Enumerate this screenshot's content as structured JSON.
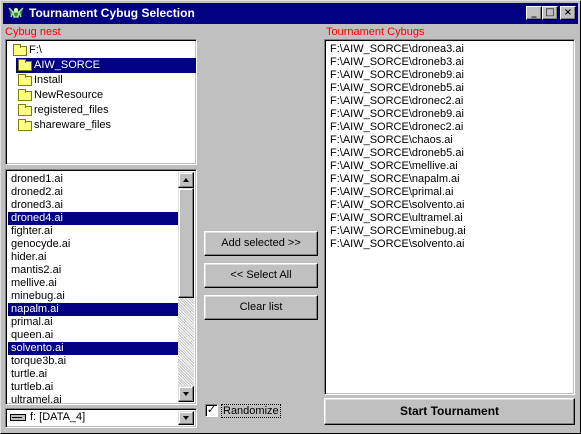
{
  "window": {
    "title": "Tournament Cybug Selection",
    "controls": {
      "minimize": "_",
      "maximize": "□",
      "close": "×"
    }
  },
  "left": {
    "nest_label": "Cybug nest",
    "directories": [
      {
        "label": "F:\\",
        "selected": false
      },
      {
        "label": "AIW_SORCE",
        "selected": true
      },
      {
        "label": "Install",
        "selected": false
      },
      {
        "label": "NewResource",
        "selected": false
      },
      {
        "label": "registered_files",
        "selected": false
      },
      {
        "label": "shareware_files",
        "selected": false
      }
    ],
    "files": [
      {
        "label": "droned1.ai",
        "selected": false
      },
      {
        "label": "droned2.ai",
        "selected": false
      },
      {
        "label": "droned3.ai",
        "selected": false
      },
      {
        "label": "droned4.ai",
        "selected": true
      },
      {
        "label": "fighter.ai",
        "selected": false
      },
      {
        "label": "genocyde.ai",
        "selected": false
      },
      {
        "label": "hider.ai",
        "selected": false
      },
      {
        "label": "mantis2.ai",
        "selected": false
      },
      {
        "label": "mellive.ai",
        "selected": false
      },
      {
        "label": "minebug.ai",
        "selected": false
      },
      {
        "label": "napalm.ai",
        "selected": true
      },
      {
        "label": "primal.ai",
        "selected": false
      },
      {
        "label": "queen.ai",
        "selected": false
      },
      {
        "label": "solvento.ai",
        "selected": true
      },
      {
        "label": "torque3b.ai",
        "selected": false
      },
      {
        "label": "turtle.ai",
        "selected": false
      },
      {
        "label": "turtleb.ai",
        "selected": false
      },
      {
        "label": "ultramel.ai",
        "selected": false
      }
    ],
    "drive": {
      "value": "f: [DATA_4]"
    }
  },
  "middle": {
    "add_selected": "Add selected >>",
    "select_all": "<< Select All",
    "clear_list": "Clear list",
    "randomize": {
      "label": "Randomize",
      "checked": true,
      "mark": "✓"
    }
  },
  "right": {
    "tournament_label": "Tournament Cybugs",
    "entries": [
      "F:\\AIW_SORCE\\dronea3.ai",
      "F:\\AIW_SORCE\\droneb3.ai",
      "F:\\AIW_SORCE\\droneb9.ai",
      "F:\\AIW_SORCE\\droneb5.ai",
      "F:\\AIW_SORCE\\dronec2.ai",
      "F:\\AIW_SORCE\\droneb9.ai",
      "F:\\AIW_SORCE\\dronec2.ai",
      "F:\\AIW_SORCE\\chaos.ai",
      "F:\\AIW_SORCE\\droneb5.ai",
      "F:\\AIW_SORCE\\mellive.ai",
      "F:\\AIW_SORCE\\napalm.ai",
      "F:\\AIW_SORCE\\primal.ai",
      "F:\\AIW_SORCE\\solvento.ai",
      "F:\\AIW_SORCE\\ultramel.ai",
      "F:\\AIW_SORCE\\minebug.ai",
      "F:\\AIW_SORCE\\solvento.ai"
    ],
    "start_button": "Start Tournament"
  },
  "icons": {
    "app": "cybug-app-icon",
    "folder": "folder-icon",
    "drive": "drive-icon",
    "scroll_up": "scroll-up-arrow-icon",
    "scroll_down": "scroll-down-arrow-icon",
    "dropdown": "dropdown-arrow-icon"
  },
  "colors": {
    "titlebar": "#000080",
    "selection": "#000080",
    "section_label": "#ff0000",
    "face": "#c0c0c0"
  }
}
